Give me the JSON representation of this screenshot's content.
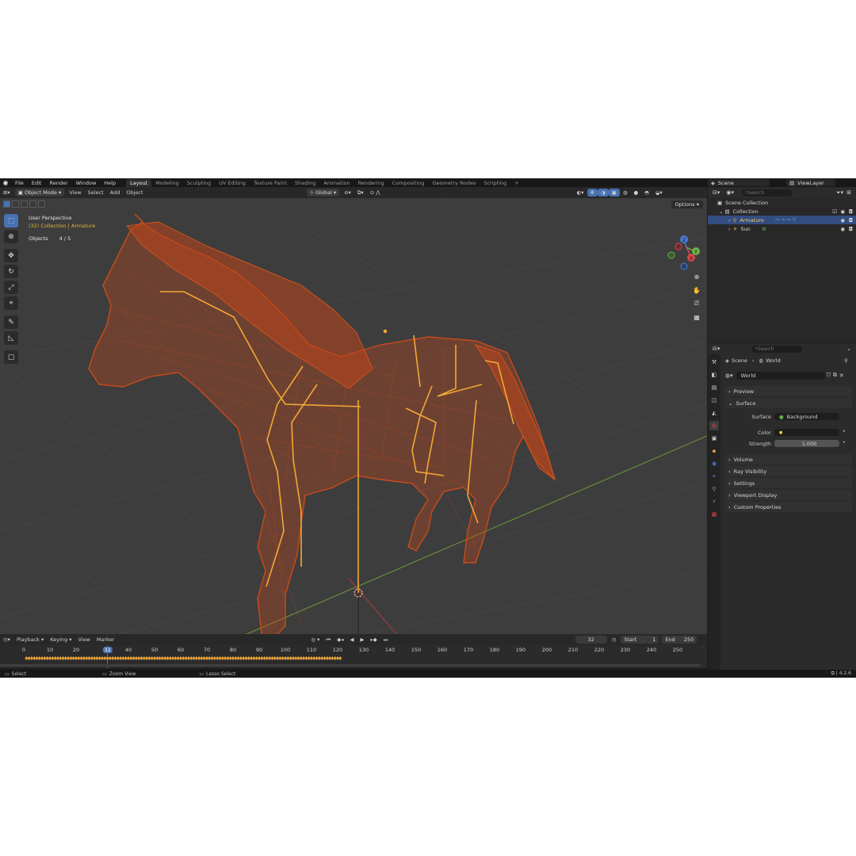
{
  "app": {
    "logo": "blender-logo-icon"
  },
  "menu": [
    "File",
    "Edit",
    "Render",
    "Window",
    "Help"
  ],
  "workspaces": [
    "Layout",
    "Modeling",
    "Sculpting",
    "UV Editing",
    "Texture Paint",
    "Shading",
    "Animation",
    "Rendering",
    "Compositing",
    "Geometry Nodes",
    "Scripting",
    "+"
  ],
  "scene": {
    "name": "Scene",
    "view_layer": "ViewLayer"
  },
  "viewport_header": {
    "mode": "Object Mode",
    "menus": [
      "View",
      "Select",
      "Add",
      "Object"
    ],
    "orientation": "Global",
    "options": "Options"
  },
  "viewport_overlay": {
    "perspective": "User Perspective",
    "collection": "(32) Collection | Armature",
    "objects_label": "Objects",
    "objects_value": "4 / 5"
  },
  "gizmo": {
    "z": "Z",
    "y": "Y",
    "x": "X"
  },
  "timeline": {
    "menus": [
      "Playback",
      "Keying",
      "View",
      "Marker"
    ],
    "current_frame": "32",
    "start_label": "Start",
    "start": "1",
    "end_label": "End",
    "end": "250",
    "frame_labels": [
      "0",
      "10",
      "20",
      "32",
      "40",
      "50",
      "60",
      "70",
      "80",
      "90",
      "100",
      "110",
      "120",
      "130",
      "140",
      "150",
      "160",
      "170",
      "180",
      "190",
      "200",
      "210",
      "220",
      "230",
      "240",
      "250"
    ]
  },
  "statusbar": {
    "select": "Select",
    "zoom": "Zoom View",
    "lasso": "Lasso Select",
    "version": "4.2.6"
  },
  "outliner": {
    "search_placeholder": "Search",
    "scene_collection": "Scene Collection",
    "collection": "Collection",
    "items": [
      {
        "label": "Armature",
        "selected": true
      },
      {
        "label": "Sun",
        "selected": false
      }
    ]
  },
  "properties": {
    "search_placeholder": "Search",
    "breadcrumb_scene": "Scene",
    "breadcrumb_world": "World",
    "world_name": "World",
    "panels": {
      "preview": "Preview",
      "surface": "Surface",
      "volume": "Volume",
      "ray_visibility": "Ray Visibility",
      "settings": "Settings",
      "viewport_display": "Viewport Display",
      "custom_properties": "Custom Properties"
    },
    "surface_label": "Surface",
    "surface_value": "Background",
    "color_label": "Color",
    "strength_label": "Strength",
    "strength_value": "1.000"
  },
  "colors": {
    "accent": "#4772b3",
    "wire": "#c94a1c",
    "bone": "#f0a836",
    "selected_row": "#334d80"
  }
}
